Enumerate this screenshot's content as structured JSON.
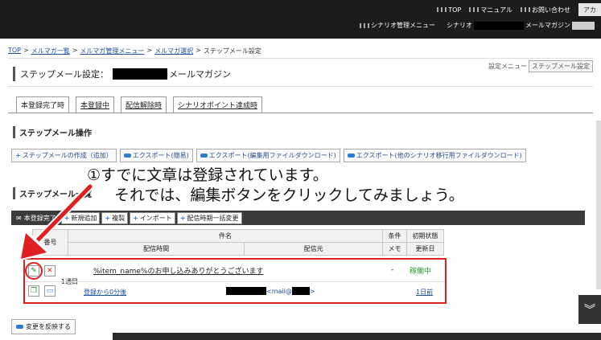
{
  "topbar": {
    "links": [
      {
        "label": "TOP"
      },
      {
        "label": "マニュアル"
      },
      {
        "label": "お問い合わせ"
      }
    ],
    "account": "アカ",
    "submenu_manage": "シナリオ管理メニュー",
    "submenu_scenario": "シナリオ",
    "submenu_magazine": "メールマガジン"
  },
  "breadcrumb": [
    "TOP",
    "メルマガ一覧",
    "メルマガ管理メニュー",
    "メルマガ選択",
    "ステップメール設定"
  ],
  "breadcrumb_sep": ">",
  "page": {
    "title_prefix": "ステップメール設定：",
    "title_suffix": "メールマガジン",
    "settings_menu_label": "設定メニュー",
    "settings_menu_value": "ステップメール設定"
  },
  "tabs": [
    {
      "label": "本登録完了時",
      "active": true
    },
    {
      "label": "本登録中",
      "active": false
    },
    {
      "label": "配信解除時",
      "active": false
    },
    {
      "label": "シナリオポイント達成時",
      "active": false
    }
  ],
  "op_section": {
    "title": "ステップメール操作",
    "buttons": [
      {
        "label": "ステップメールの作成（追加）",
        "icon": "plus-icon"
      },
      {
        "label": "エクスポート(簡易)",
        "icon": "arrow-icon"
      },
      {
        "label": "エクスポート(編集用ファイルダウンロード)",
        "icon": "arrow-icon"
      },
      {
        "label": "エクスポート(他のシナリオ移行用ファイルダウンロード)",
        "icon": "arrow-icon"
      }
    ]
  },
  "annotation": {
    "line1": "①すでに文章は登録されています。",
    "line2": "それでは、編集ボタンをクリックしてみましょう。"
  },
  "list_section": {
    "title": "ステップメール一覧",
    "toolbar_label": "本登録完了",
    "buttons": [
      "新規追加",
      "複製",
      "インポート",
      "配信時期一括変更"
    ]
  },
  "table": {
    "header_top": {
      "col_num": "番号",
      "col_subject": "件名",
      "col_cond": "条件",
      "col_init": "初期状態"
    },
    "header_bottom": {
      "col_timing": "配信時間",
      "col_from": "配信元",
      "col_memo": "メモ",
      "col_updated": "更新日"
    },
    "row": {
      "nth": "1通目",
      "subject": "%item_name%のお申し込みありがとうございます",
      "condition": "-",
      "status": "稼働中",
      "timing": "登録から0分後",
      "from_prefix": "<mail@",
      "from_suffix": ">",
      "updated": "1日前"
    }
  },
  "reflect_button": "変更を反映する"
}
